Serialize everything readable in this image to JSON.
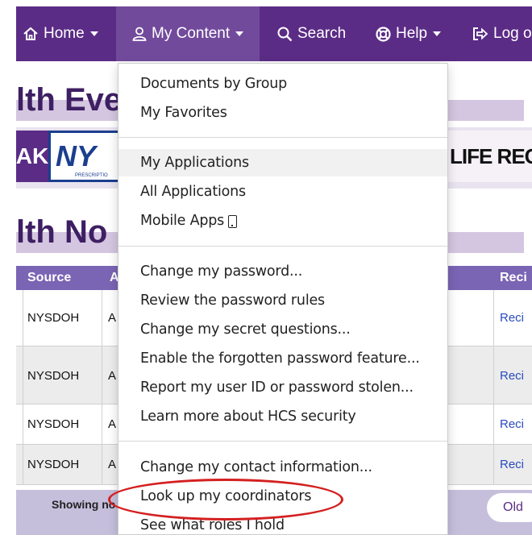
{
  "nav": {
    "home": "Home",
    "my_content": "My Content",
    "search": "Search",
    "help": "Help",
    "logout": "Log o"
  },
  "page": {
    "heading_1": "lth Eve",
    "heading_2": "lth No",
    "banner_ak": "AK",
    "banner_ny": "NY",
    "banner_prescription": "PRESCRIPTIO",
    "banner_life": "LIFE REC"
  },
  "table": {
    "headers": [
      "Source",
      "A",
      "Reci"
    ],
    "rows": [
      {
        "source": "NYSDOH",
        "a": "A",
        "link": "Reci"
      },
      {
        "source": "NYSDOH",
        "a": "A",
        "link": "Reci"
      },
      {
        "source": "NYSDOH",
        "a": "A",
        "link": "Reci"
      },
      {
        "source": "NYSDOH",
        "a": "A",
        "link": "Reci"
      }
    ],
    "showing": "Showing no",
    "older_button": "Old"
  },
  "dropdown": {
    "items": [
      {
        "label": "Documents by Group"
      },
      {
        "label": "My Favorites"
      },
      {
        "label": "My Applications"
      },
      {
        "label": "All Applications"
      },
      {
        "label": "Mobile Apps"
      },
      {
        "label": "Change my password..."
      },
      {
        "label": "Review the password rules"
      },
      {
        "label": "Change my secret questions..."
      },
      {
        "label": "Enable the forgotten password feature..."
      },
      {
        "label": "Report my user ID or password stolen..."
      },
      {
        "label": "Learn more about HCS security"
      },
      {
        "label": "Change my contact information..."
      },
      {
        "label": "Look up my coordinators"
      },
      {
        "label": "See what roles I hold"
      }
    ]
  },
  "colors": {
    "nav_bg": "#5b2c86",
    "nav_active": "#724a9c",
    "table_header": "#7a64b4",
    "highlight_ring": "#d42020",
    "link": "#2a4bbf"
  }
}
